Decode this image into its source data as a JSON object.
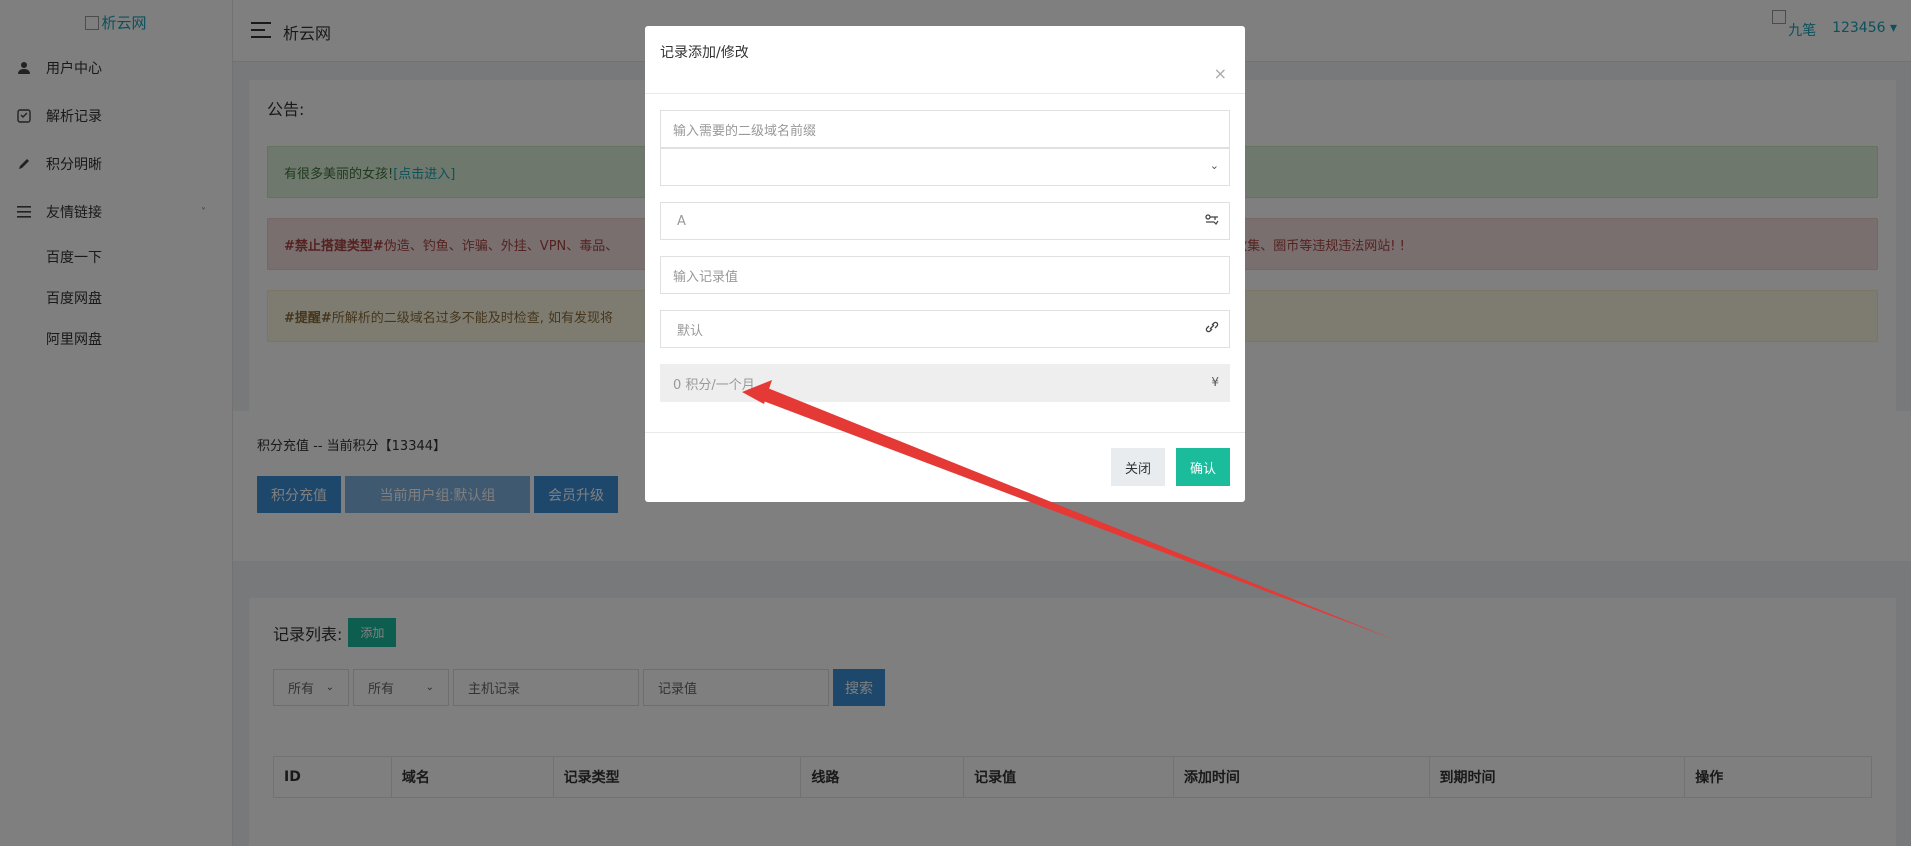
{
  "sidebar": {
    "logo_text": "析云网",
    "items": [
      {
        "label": "用户中心",
        "icon": "user-icon"
      },
      {
        "label": "解析记录",
        "icon": "record-icon"
      },
      {
        "label": "积分明晰",
        "icon": "pencil-icon"
      },
      {
        "label": "友情链接",
        "icon": "list-icon"
      }
    ],
    "sub_items": [
      "百度一下",
      "百度网盘",
      "阿里网盘"
    ]
  },
  "header": {
    "title": "析云网",
    "user_name": "九笔",
    "user_id": "123456 ▾"
  },
  "notice": {
    "title": "公告:",
    "success_text": "有很多美丽的女孩!",
    "success_link": "[点击进入]",
    "danger_bold": "#禁止搭建类型#",
    "danger_text": " 伪造、钓鱼、诈骗、外挂、VPN、毒品、",
    "danger_tail": "信息收集、圈币等违规违法网站! !",
    "warning_bold": "#提醒#",
    "warning_text": " 所解析的二级域名过多不能及时检查, 如有发现将"
  },
  "charge": {
    "title": "积分充值 -- 当前积分【13344】",
    "btn_recharge": "积分充值",
    "btn_group": "当前用户组:默认组",
    "btn_upgrade": "会员升级"
  },
  "records": {
    "title": "记录列表:",
    "add_label": "添加",
    "filter_1": "所有",
    "filter_2": "所有",
    "host_placeholder": "主机记录",
    "value_placeholder": "记录值",
    "search_label": "搜索",
    "columns": [
      "ID",
      "域名",
      "记录类型",
      "线路",
      "记录值",
      "添加时间",
      "到期时间",
      "操作"
    ]
  },
  "modal": {
    "title": "记录添加/修改",
    "close_glyph": "×",
    "subdomain_placeholder": "输入需要的二级域名前缀",
    "record_type": "A",
    "value_placeholder": "输入记录值",
    "line": "默认",
    "cost": "0 积分/一个月",
    "currency": "¥",
    "btn_close": "关闭",
    "btn_ok": "确认"
  },
  "colors": {
    "accent_teal": "#1abc9c",
    "accent_blue": "#3a8fd6",
    "annotation_red": "#e53935"
  }
}
